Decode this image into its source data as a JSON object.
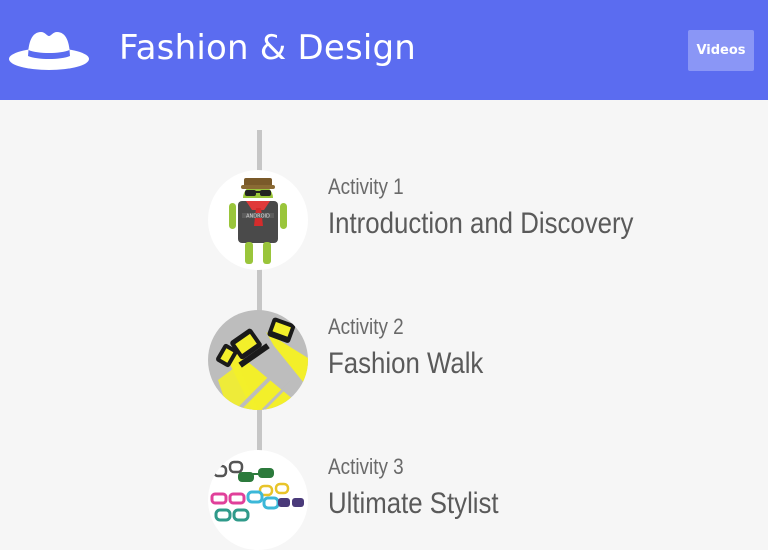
{
  "header": {
    "title": "Fashion & Design",
    "logo_icon": "hat-icon",
    "background_color": "#5b6cf0",
    "videos_label": "Videos",
    "videos_button_color": "#8a96f6"
  },
  "timeline": {
    "line_color": "#c6c6c6",
    "activities": [
      {
        "number": "Activity 1",
        "name": "Introduction and Discovery",
        "icon": "android-robot-icon"
      },
      {
        "number": "Activity 2",
        "name": "Fashion Walk",
        "icon": "runway-spotlight-icon"
      },
      {
        "number": "Activity 3",
        "name": "Ultimate Stylist",
        "icon": "sunglasses-collage-icon"
      }
    ]
  }
}
